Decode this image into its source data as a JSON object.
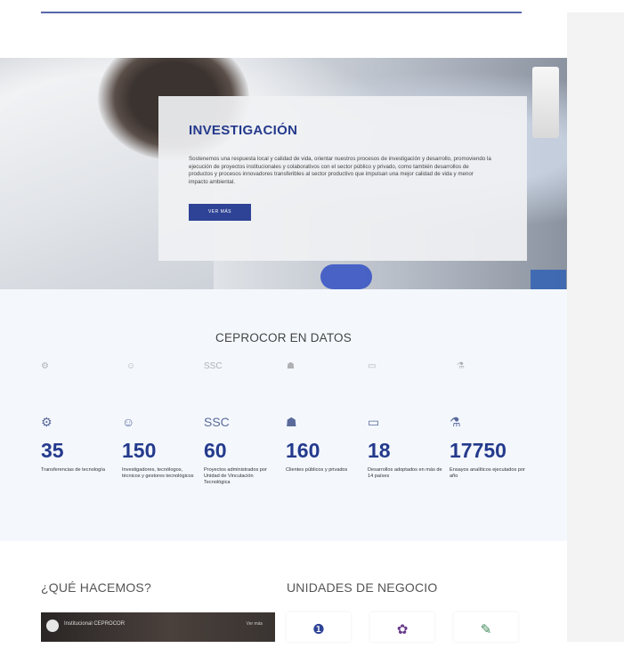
{
  "hero": {
    "title": "INVESTIGACIÓN",
    "body": "Sostenemos una respuesta local y calidad de vida, orientar nuestros procesos de investigación y desarrollo, promoviendo la ejecución de proyectos institucionales y colaborativos con el sector público y privado, como también desarrollos de productos y procesos innovadores transferibles al sector productivo que impulsan una mejor calidad de vida y menor impacto ambiental.",
    "button_label": "VER MÁS"
  },
  "data_section": {
    "title": "CEPROCOR EN DATOS",
    "stats": [
      {
        "icon": "handshake-icon",
        "icon_glyph": "⚙",
        "value": "35",
        "label": "Transferencias de tecnología"
      },
      {
        "icon": "people-icon",
        "icon_glyph": "☺",
        "value": "150",
        "label": "Investigadores, tecnólogos, técnicos y gestores tecnológicos"
      },
      {
        "icon": "ssc-icon",
        "icon_glyph": "SSC",
        "value": "60",
        "label": "Proyectos administrados por Unidad de Vinculación Tecnológica"
      },
      {
        "icon": "team-icon",
        "icon_glyph": "☗",
        "value": "160",
        "label": "Clientes públicos y privados"
      },
      {
        "icon": "computer-icon",
        "icon_glyph": "▭",
        "value": "18",
        "label": "Desarrollos adoptados en más de 14 países"
      },
      {
        "icon": "microscope-icon",
        "icon_glyph": "⚗",
        "value": "17750",
        "label": "Ensayos analíticos ejecutados por año"
      }
    ]
  },
  "what_we_do": {
    "heading": "¿QUÉ HACEMOS?",
    "video_title": "Institucional CEPROCOR",
    "video_more": "Ver más"
  },
  "business_units": {
    "heading": "UNIDADES DE NEGOCIO",
    "cards": [
      {
        "icon": "flask-icon",
        "glyph": "❶",
        "color": "#2e4396"
      },
      {
        "icon": "molecule-icon",
        "glyph": "✿",
        "color": "#6a3b8c"
      },
      {
        "icon": "capsule-icon",
        "glyph": "✎",
        "color": "#3f8a5a"
      }
    ]
  }
}
